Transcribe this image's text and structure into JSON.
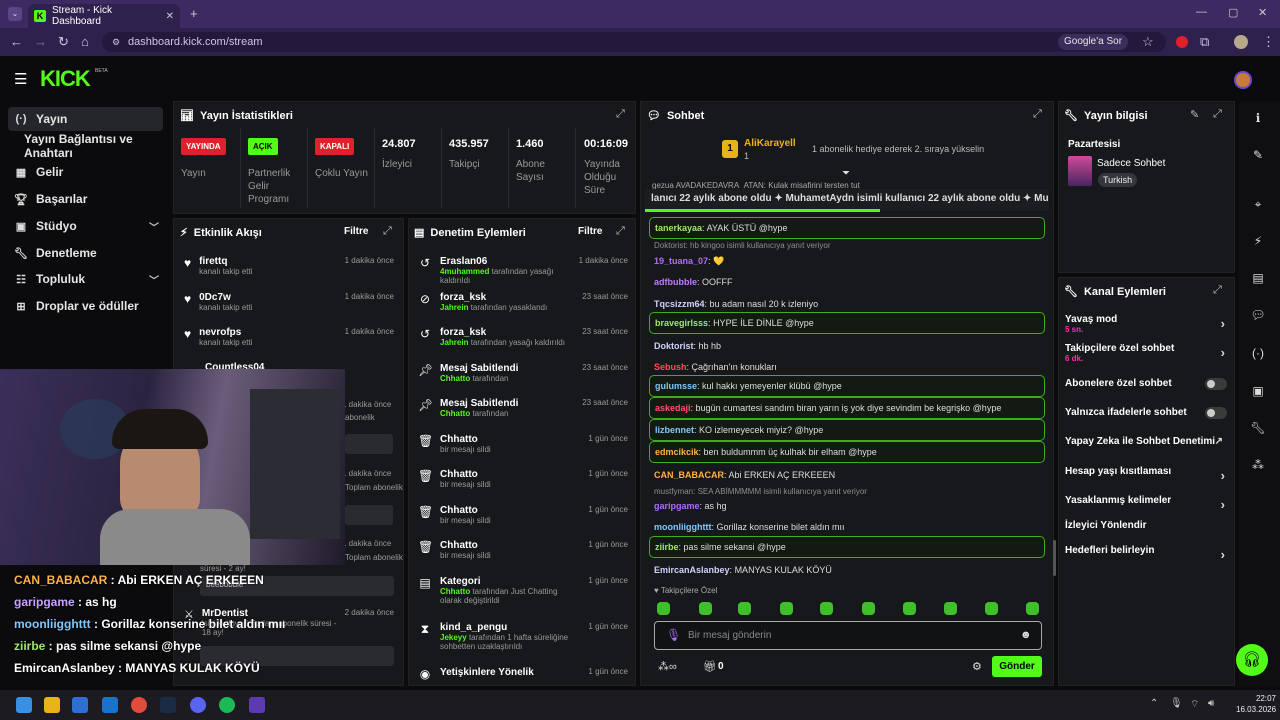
{
  "browser": {
    "tab_title": "Stream - Kick Dashboard",
    "url": "dashboard.kick.com/stream",
    "google_btn": "Google'a Sor"
  },
  "app": {
    "logo": "KICK",
    "beta": "BETA"
  },
  "sidebar": {
    "items": [
      {
        "label": "Yayın",
        "icon": "broadcast-icon",
        "active": true
      },
      {
        "label": "Yayın Bağlantısı ve Anahtarı",
        "icon": "",
        "active": false
      },
      {
        "label": "Gelir",
        "icon": "revenue-icon"
      },
      {
        "label": "Başarılar",
        "icon": "trophy-icon"
      },
      {
        "label": "Stüdyo",
        "icon": "studio-icon",
        "chevron": true
      },
      {
        "label": "Denetleme",
        "icon": "wrench-icon"
      },
      {
        "label": "Topluluk",
        "icon": "community-icon",
        "chevron": true
      },
      {
        "label": "Droplar ve ödüller",
        "icon": "drops-icon"
      }
    ]
  },
  "stats": {
    "title": "Yayın İstatistikleri",
    "items": [
      {
        "badge": "YAYINDA",
        "badge_color": "#e0202b",
        "label": "Yayın"
      },
      {
        "badge": "AÇIK",
        "badge_color": "#53fc18",
        "label": "Partnerlik Gelir Programı"
      },
      {
        "badge": "KAPALI",
        "badge_color": "#e0202b",
        "label": "Çoklu Yayın"
      },
      {
        "value": "24.807",
        "label": "İzleyici"
      },
      {
        "value": "435.957",
        "label": "Takipçi"
      },
      {
        "value": "1.460",
        "label": "Abone Sayısı"
      },
      {
        "value": "00:16:09",
        "label": "Yayında Olduğu Süre"
      }
    ]
  },
  "activity": {
    "title": "Etkinlik Akışı",
    "filter": "Filtre",
    "events": [
      {
        "name": "firettq",
        "sub": "kanalı takip etti",
        "time": "1 dakika önce"
      },
      {
        "name": "0Dc7w",
        "sub": "kanalı takip etti",
        "time": "1 dakika önce"
      },
      {
        "name": "nevrofps",
        "sub": "kanalı takip etti",
        "time": "1 dakika önce"
      },
      {
        "name": "Countless04",
        "sub": "",
        "time": ""
      },
      {
        "name": "",
        "sub": "abonelik",
        "time": "1 dakika önce"
      },
      {
        "name": "",
        "sub": "Toplam abonelik",
        "time": "1 dakika önce"
      },
      {
        "name": "",
        "sub": "Toplam abonelik",
        "time": "1 dakika önce"
      },
      {
        "name": "MrDentist",
        "sub": "isini kutluyor! Toplam abonelik süresi - 18 ay!",
        "time": "2 dakika önce"
      }
    ],
    "partial1": "süresi - 2 ay!",
    "partial2": "beebobble"
  },
  "moderation": {
    "title": "Denetim Eylemleri",
    "filter": "Filtre",
    "events": [
      {
        "name": "Eraslan06",
        "actor": "4muhammed",
        "sub": "tarafından yasağı kaldırıldı",
        "time": "1 dakika önce",
        "icon": "undo-icon"
      },
      {
        "name": "forza_ksk",
        "actor": "Jahrein",
        "sub": "tarafından yasaklandı",
        "time": "23 saat önce",
        "icon": "ban-icon"
      },
      {
        "name": "forza_ksk",
        "actor": "Jahrein",
        "sub": "tarafından yasağı kaldırıldı",
        "time": "23 saat önce",
        "icon": "undo-icon"
      },
      {
        "name": "Mesaj Sabitlendi",
        "actor": "Chhatto",
        "sub": "tarafından",
        "time": "23 saat önce",
        "icon": "pin-icon"
      },
      {
        "name": "Mesaj Sabitlendi",
        "actor": "Chhatto",
        "sub": "tarafından",
        "time": "23 saat önce",
        "icon": "pin-icon"
      },
      {
        "name": "Chhatto",
        "actor": "",
        "sub": "bir mesajı sildi",
        "time": "1 gün önce",
        "icon": "trash-icon"
      },
      {
        "name": "Chhatto",
        "actor": "",
        "sub": "bir mesajı sildi",
        "time": "1 gün önce",
        "icon": "trash-icon"
      },
      {
        "name": "Chhatto",
        "actor": "",
        "sub": "bir mesajı sildi",
        "time": "1 gün önce",
        "icon": "trash-icon"
      },
      {
        "name": "Chhatto",
        "actor": "",
        "sub": "bir mesajı sildi",
        "time": "1 gün önce",
        "icon": "trash-icon"
      },
      {
        "name": "Kategori",
        "actor": "Chhatto",
        "sub": "tarafından Just Chatting olarak değiştirildi",
        "time": "1 gün önce",
        "icon": "category-icon"
      },
      {
        "name": "kind_a_pengu",
        "actor": "Jekeyy",
        "sub": "tarafından 1 hafta süreliğine sohbetten uzaklaştırıldı",
        "time": "1 gün önce",
        "icon": "hourglass-icon"
      },
      {
        "name": "Yetişkinlere Yönelik",
        "actor": "",
        "sub": "",
        "time": "1 gün önce",
        "icon": "eye-icon"
      }
    ]
  },
  "chat": {
    "title": "Sohbet",
    "pinned": {
      "user": "AliKarayell",
      "badge": "1",
      "sub": "1",
      "text": "1 abonelik hediye ederek 2. sıraya yükselin"
    },
    "partial": "gezua AVADAKEDAVRA_ATAN: Kulak misafirini tersten tut",
    "ticker": "lanıcı 22 aylık abone oldu ✦ MuhametAydn isimli kullanıcı 22 aylık abone oldu ✦ Muha",
    "messages": [
      {
        "user": "tanerkayaa",
        "color": "#9fe870",
        "text": "AYAK ÜSTÜ @hype",
        "box": true
      },
      {
        "system": "Doktorist: hb kingoo isimli kullanıcıya yanıt veriyor"
      },
      {
        "user": "19_tuana_07",
        "color": "#b06cff",
        "text": "💛",
        "box": false
      },
      {
        "user": "adfbubble",
        "color": "#c07bff",
        "text": "OOFFF",
        "box": false
      },
      {
        "user": "Tqcsizzm64",
        "color": "#cfd3ff",
        "text": "bu adam nasıl 20 k izleniyo",
        "box": false
      },
      {
        "user": "bravegirlsss",
        "color": "#9fe870",
        "text": "HYPE İLE DİNLE @hype",
        "box": true
      },
      {
        "user": "Doktorist",
        "color": "#cfd3ff",
        "text": "hb hb",
        "box": false
      },
      {
        "user": "Sebush",
        "color": "#ff4f4f",
        "text": "Çağrıhan'ın konukları",
        "box": false
      },
      {
        "user": "gulumsse",
        "color": "#80c8ff",
        "text": "kul hakkı yemeyenler klübü @hype",
        "box": true
      },
      {
        "user": "askedaji",
        "color": "#ff4f70",
        "text": "bugün cumartesi sandım biran yarın iş yok diye sevindim be kegrişko @hype",
        "box": true
      },
      {
        "user": "lizbennet",
        "color": "#80c8ff",
        "text": "KO izlemeyecek miyiz? @hype",
        "box": true
      },
      {
        "user": "edmcikcik",
        "color": "#ffb347",
        "text": "ben buldummm üç kulhak bir elham @hype",
        "box": true
      },
      {
        "user": "CAN_BABACAR",
        "color": "#ffb347",
        "text": "Abi ERKEN AÇ ERKEEEN",
        "box": false
      },
      {
        "system": "mustfyman: SEA ABİMMMMM isimli kullanıcıya yanıt veriyor"
      },
      {
        "user": "garipgame",
        "color": "#b06cff",
        "text": "as hg",
        "box": false
      },
      {
        "user": "moonliigghttt",
        "color": "#80c8ff",
        "text": "Gorillaz konserine bilet aldın mıı",
        "box": false
      },
      {
        "user": "ziirbe",
        "color": "#9fe870",
        "text": "pas silme sekansi @hype",
        "box": true
      },
      {
        "user": "EmircanAslanbey",
        "color": "#cfd3ff",
        "text": "MANYAS KULAK KÖYÜ",
        "box": false
      }
    ],
    "followers_only": "Takipçilere Özel",
    "placeholder": "Bir mesaj gönderin",
    "count": "0",
    "send": "Gönder"
  },
  "stream_info": {
    "title": "Yayın bilgisi",
    "day": "Pazartesisi",
    "name": "Sadece Sohbet",
    "lang": "Turkish"
  },
  "channel_actions": {
    "title": "Kanal Eylemleri",
    "items": [
      {
        "label": "Yavaş mod",
        "sub": "5 sn.",
        "type": "chevron"
      },
      {
        "label": "Takipçilere özel sohbet",
        "sub": "6 dk.",
        "type": "chevron"
      },
      {
        "label": "Abonelere özel sohbet",
        "type": "toggle"
      },
      {
        "label": "Yalnızca ifadelerle sohbet",
        "type": "toggle"
      },
      {
        "label": "Yapay Zeka ile Sohbet Denetimi",
        "type": "external"
      },
      {
        "label": "Hesap yaşı kısıtlaması",
        "type": "chevron"
      },
      {
        "label": "Yasaklanmış kelimeler",
        "type": "chevron"
      },
      {
        "label": "İzleyici Yönlendir",
        "type": "none"
      },
      {
        "label": "Hedefleri belirleyin",
        "type": "chevron"
      }
    ]
  },
  "overlay_chat": [
    {
      "user": "CAN_BABACAR",
      "color": "#ffb347",
      "text": "Abi ERKEN AÇ ERKEEEN"
    },
    {
      "user": "garipgame",
      "color": "#c9a3ff",
      "text": "as hg"
    },
    {
      "user": "moonliigghttt",
      "color": "#80c8ff",
      "text": "Gorillaz konserine bilet aldın mıı"
    },
    {
      "user": "ziirbe",
      "color": "#9fe870",
      "text": "pas silme sekansi @hype"
    },
    {
      "user": "EmircanAslanbey",
      "color": "#ffffff",
      "text": "MANYAS KULAK KÖYÜ"
    }
  ],
  "taskbar": {
    "time": "22:07",
    "date": "16.03.2026"
  }
}
